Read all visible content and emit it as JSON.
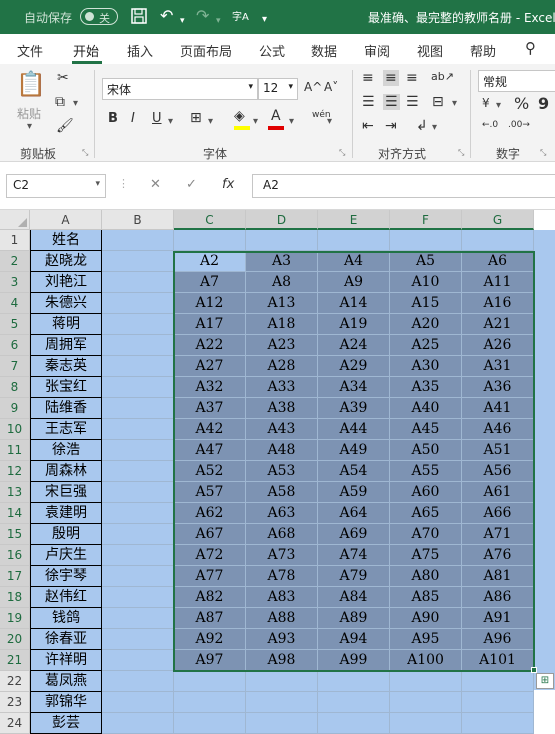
{
  "titlebar": {
    "autosave_label": "自动保存",
    "autosave_state": "关",
    "title": "最准确、最完整的教师名册 - Excel"
  },
  "tabs": [
    "文件",
    "开始",
    "插入",
    "页面布局",
    "公式",
    "数据",
    "审阅",
    "视图",
    "帮助"
  ],
  "active_tab": "开始",
  "ribbon": {
    "paste_label": "粘贴",
    "font_name": "宋体",
    "font_size": "12",
    "number_format": "常规",
    "groups": {
      "clipboard": "剪贴板",
      "font": "字体",
      "alignment": "对齐方式",
      "number": "数字"
    },
    "bold": "B",
    "italic": "I",
    "underline": "U",
    "font_grow": "A^",
    "font_shrink": "A˅",
    "wen_label": "wén",
    "currency": "¥",
    "percent": "%",
    "comma": "9"
  },
  "formula_bar": {
    "name_box": "C2",
    "formula": "A2",
    "fx": "fx"
  },
  "columns": [
    "A",
    "B",
    "C",
    "D",
    "E",
    "F",
    "G"
  ],
  "rows": [
    "1",
    "2",
    "3",
    "4",
    "5",
    "6",
    "7",
    "8",
    "9",
    "10",
    "11",
    "12",
    "13",
    "14",
    "15",
    "16",
    "17",
    "18",
    "19",
    "20",
    "21",
    "22",
    "23",
    "24"
  ],
  "col_a": [
    "姓名",
    "赵晓龙",
    "刘艳江",
    "朱德兴",
    "蒋明",
    "周拥军",
    "秦志英",
    "张宝红",
    "陆维香",
    "王志军",
    "徐浩",
    "周森林",
    "宋巨强",
    "袁建明",
    "殷明",
    "卢庆生",
    "徐宇琴",
    "赵伟红",
    "钱鸽",
    "徐春亚",
    "许祥明",
    "葛凤燕",
    "郭锦华",
    "彭芸"
  ],
  "table": [
    [
      "A2",
      "A3",
      "A4",
      "A5",
      "A6"
    ],
    [
      "A7",
      "A8",
      "A9",
      "A10",
      "A11"
    ],
    [
      "A12",
      "A13",
      "A14",
      "A15",
      "A16"
    ],
    [
      "A17",
      "A18",
      "A19",
      "A20",
      "A21"
    ],
    [
      "A22",
      "A23",
      "A24",
      "A25",
      "A26"
    ],
    [
      "A27",
      "A28",
      "A29",
      "A30",
      "A31"
    ],
    [
      "A32",
      "A33",
      "A34",
      "A35",
      "A36"
    ],
    [
      "A37",
      "A38",
      "A39",
      "A40",
      "A41"
    ],
    [
      "A42",
      "A43",
      "A44",
      "A45",
      "A46"
    ],
    [
      "A47",
      "A48",
      "A49",
      "A50",
      "A51"
    ],
    [
      "A52",
      "A53",
      "A54",
      "A55",
      "A56"
    ],
    [
      "A57",
      "A58",
      "A59",
      "A60",
      "A61"
    ],
    [
      "A62",
      "A63",
      "A64",
      "A65",
      "A66"
    ],
    [
      "A67",
      "A68",
      "A69",
      "A70",
      "A71"
    ],
    [
      "A72",
      "A73",
      "A74",
      "A75",
      "A76"
    ],
    [
      "A77",
      "A78",
      "A79",
      "A80",
      "A81"
    ],
    [
      "A82",
      "A83",
      "A84",
      "A85",
      "A86"
    ],
    [
      "A87",
      "A88",
      "A89",
      "A90",
      "A91"
    ],
    [
      "A92",
      "A93",
      "A94",
      "A95",
      "A96"
    ],
    [
      "A97",
      "A98",
      "A99",
      "A100",
      "A101"
    ]
  ],
  "colors": {
    "accent": "#217346",
    "selection_bg": "#a9c8ee",
    "range_bg": "#7d93b3",
    "active_cell_bg": "#a9c8ee"
  }
}
